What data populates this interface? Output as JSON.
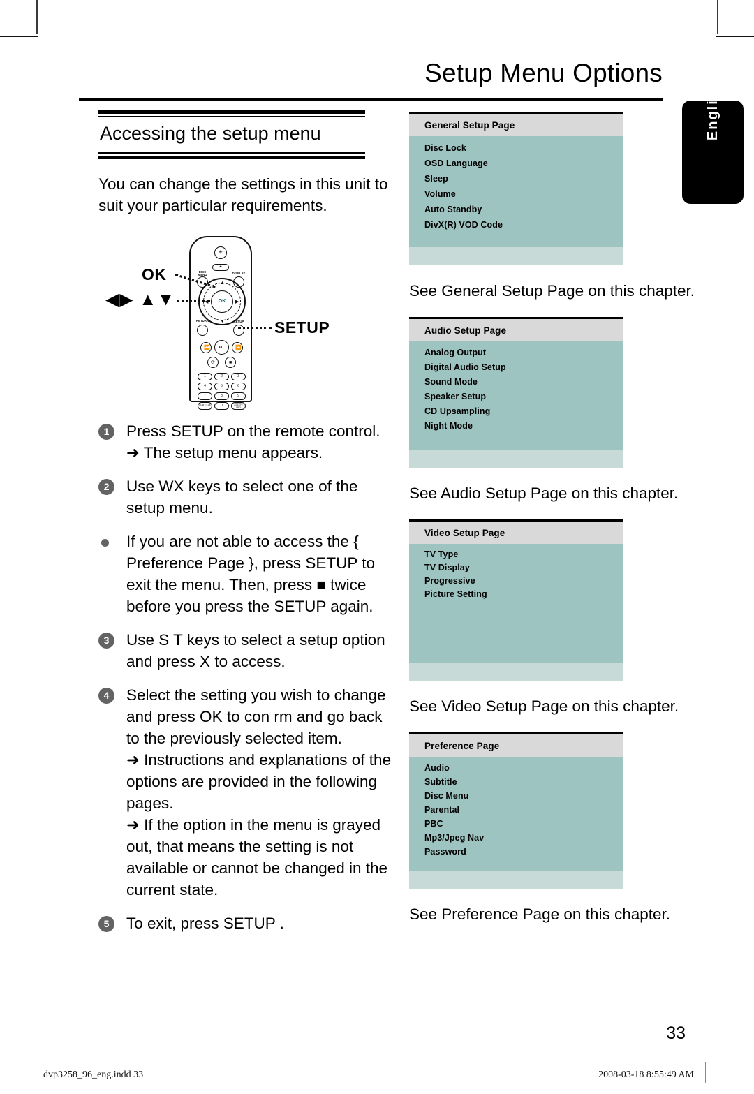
{
  "page": {
    "chapter_title": "Setup Menu Options",
    "language_tab": "English",
    "folio": "33"
  },
  "section": {
    "heading": "Accessing the setup menu",
    "intro": "You can change the settings in this unit to suit your particular requirements."
  },
  "remote_figure": {
    "callout_ok": "OK",
    "callout_setup": "SETUP",
    "callout_arrows": "◀▶ ▲▼",
    "ok_button_label": "OK",
    "button_labels": {
      "power": "⏻",
      "open_close": "⏏",
      "disc_menu": "DISC\nMENU",
      "display": "DISPLAY",
      "return": "RETURN\nTITLE",
      "setup": "SETUP",
      "prev": "◄◄",
      "play_pause": "►❚❚",
      "next": "►►",
      "slow": "⟳",
      "stop": "■",
      "subtitle": "SUBTITLE",
      "audio": "AUDIO/\nCREATE MP3"
    },
    "keypad": [
      "1",
      "2",
      "3",
      "4",
      "5",
      "6",
      "7",
      "8",
      "9",
      "SUBTITLE",
      "0",
      "AUDIO/CREATE MP3"
    ]
  },
  "steps": [
    {
      "marker": "1",
      "type": "number",
      "lines": [
        "Press SETUP on the remote control.",
        "➜ The setup menu appears."
      ]
    },
    {
      "marker": "2",
      "type": "number",
      "lines": [
        "Use WX keys to select one of the setup menu."
      ]
    },
    {
      "marker": "●",
      "type": "bullet",
      "lines": [
        "If you are not able to access the { Preference Page }, press SETUP to exit the menu. Then, press ■ twice before you press the SETUP again."
      ]
    },
    {
      "marker": "3",
      "type": "number",
      "lines": [
        "Use S T keys to select a setup option and press X to access."
      ]
    },
    {
      "marker": "4",
      "type": "number",
      "lines": [
        "Select the setting you wish to change and press OK to con rm and go back to the previously selected item.",
        "➜ Instructions and explanations of the options are provided in the following pages.",
        "➜ If the option in the menu is grayed out, that means the setting is not available or cannot be changed in the current state."
      ]
    },
    {
      "marker": "5",
      "type": "number",
      "lines": [
        "To exit, press SETUP ."
      ]
    }
  ],
  "osd_menus": [
    {
      "title": "General Setup Page",
      "items": [
        "Disc Lock",
        "OSD Language",
        "Sleep",
        "Volume",
        "Auto Standby",
        "DivX(R) VOD Code"
      ],
      "item_spacing": 22,
      "items_height": 144,
      "see_line": "See  General Setup Page  on this chapter."
    },
    {
      "title": "Audio Setup Page",
      "items": [
        "Analog Output",
        "Digital Audio Setup",
        "Sound Mode",
        "Speaker Setup",
        "CD Upsampling",
        "Night Mode"
      ],
      "item_spacing": 21,
      "items_height": 140,
      "see_line": "See  Audio Setup Page  on this chapter."
    },
    {
      "title": "Video Setup Page",
      "items": [
        "TV Type",
        "TV Display",
        "Progressive",
        "Picture Setting"
      ],
      "item_spacing": 19,
      "items_height": 155,
      "see_line": "See  Video Setup Page  on this chapter."
    },
    {
      "title": "Preference Page",
      "items": [
        "Audio",
        "Subtitle",
        "Disc Menu",
        "Parental",
        "PBC",
        "Mp3/Jpeg Nav",
        "Password"
      ],
      "item_spacing": 20,
      "items_height": 148,
      "see_line": "See  Preference Page  on this chapter."
    }
  ],
  "footer": {
    "filename": "dvp3258_96_eng.indd   33",
    "timestamp": "2008-03-18   8:55:49 AM"
  },
  "colors": {
    "osd_body": "#9ec4c1",
    "osd_header": "#d9d9d9",
    "osd_footer": "#c8dad8",
    "marker": "#636363",
    "ok_text": "#0b5c60"
  }
}
